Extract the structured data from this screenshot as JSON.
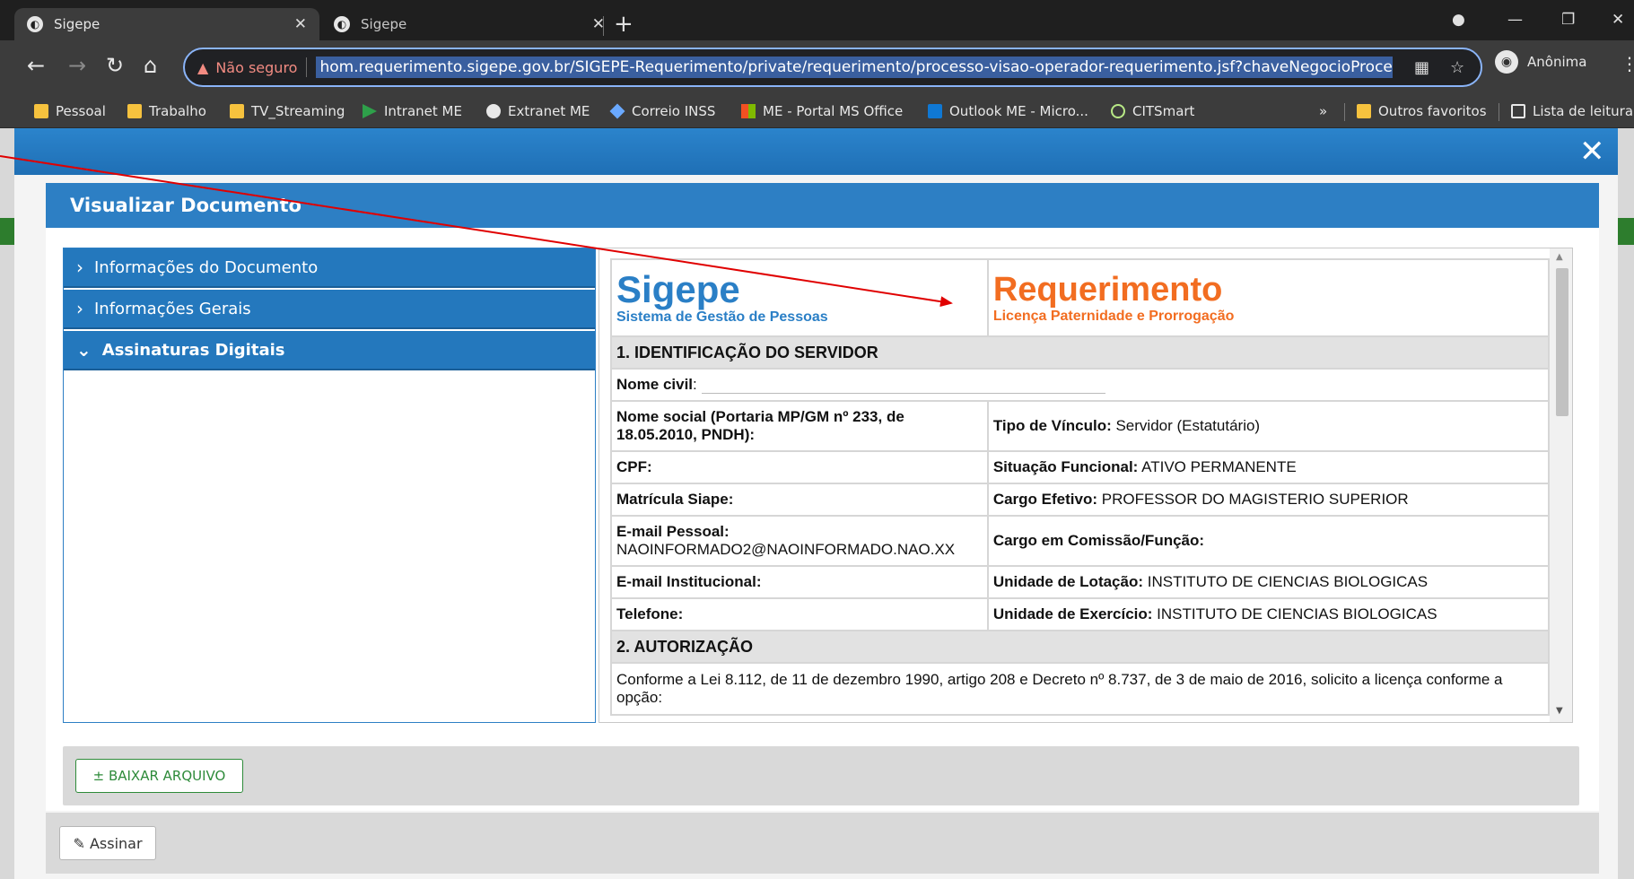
{
  "browser": {
    "tabs": [
      {
        "title": "Sigepe",
        "active": true
      },
      {
        "title": "Sigepe",
        "active": false
      }
    ],
    "new_tab_symbol": "+",
    "security_label": "Não seguro",
    "url": "hom.requerimento.sigepe.gov.br/SIGEPE-Requerimento/private/requerimento/processo-visao-operador-requerimento.jsf?chaveNegocioProcesso",
    "profile_label": "Anônima",
    "bookmarks": [
      {
        "label": "Pessoal",
        "icon": "folder-icon"
      },
      {
        "label": "Trabalho",
        "icon": "folder-icon"
      },
      {
        "label": "TV_Streaming",
        "icon": "folder-icon"
      },
      {
        "label": "Intranet ME",
        "icon": "arrow-icon"
      },
      {
        "label": "Extranet ME",
        "icon": "wordpress-icon"
      },
      {
        "label": "Correio INSS",
        "icon": "diamond-icon"
      },
      {
        "label": "ME - Portal MS Office",
        "icon": "ms-office-icon"
      },
      {
        "label": "Outlook ME - Micro...",
        "icon": "outlook-icon"
      },
      {
        "label": "CITSmart",
        "icon": "citsmart-icon"
      }
    ],
    "bookmarks_overflow": "»",
    "other_favorites": "Outros favoritos",
    "reading_list": "Lista de leitura"
  },
  "modal": {
    "close_symbol": "✕",
    "panel_title": "Visualizar Documento",
    "accordion": [
      {
        "label": "Informações do Documento",
        "open": false
      },
      {
        "label": "Informações Gerais",
        "open": false
      },
      {
        "label": "Assinaturas Digitais",
        "open": true
      }
    ],
    "download_button": "± BAIXAR ARQUIVO",
    "sign_button": "✎ Assinar"
  },
  "document": {
    "brand_name": "Sigepe",
    "brand_subtitle": "Sistema de Gestão de Pessoas",
    "doc_title": "Requerimento",
    "doc_subtitle": "Licença Paternidade e Prorrogação",
    "section1": "1. IDENTIFICAÇÃO DO SERVIDOR",
    "rows": {
      "nome_civil_label": "Nome civil",
      "nome_civil_sep": ":",
      "nome_social_label": "Nome social (Portaria MP/GM nº 233, de 18.05.2010, PNDH):",
      "tipo_vinculo_label": "Tipo de Vínculo:",
      "tipo_vinculo_value": " Servidor (Estatutário)",
      "cpf_label": "CPF:",
      "situacao_label": "Situação Funcional:",
      "situacao_value": " ATIVO PERMANENTE",
      "matricula_label": "Matrícula Siape:",
      "cargo_efetivo_label": "Cargo Efetivo:",
      "cargo_efetivo_value": " PROFESSOR DO MAGISTERIO SUPERIOR",
      "email_pessoal_label": "E-mail Pessoal:",
      "email_pessoal_value": "NAOINFORMADO2@NAOINFORMADO.NAO.XX",
      "cargo_comissao_label": "Cargo em Comissão/Função:",
      "email_inst_label": "E-mail Institucional:",
      "unidade_lotacao_label": "Unidade de Lotação:",
      "unidade_lotacao_value": " INSTITUTO DE CIENCIAS BIOLOGICAS",
      "telefone_label": "Telefone:",
      "unidade_exercicio_label": "Unidade de Exercício:",
      "unidade_exercicio_value": " INSTITUTO DE CIENCIAS BIOLOGICAS"
    },
    "section2": "2. AUTORIZAÇÃO",
    "authorization_text": "Conforme a Lei 8.112, de 11 de dezembro 1990, artigo 208 e Decreto nº 8.737, de 3 de maio de 2016, solicito a licença conforme a opção:"
  },
  "colors": {
    "brand_blue": "#2a7fc6",
    "brand_orange": "#f26d21",
    "header_blue": "#2d7fc4",
    "annotation_red": "#e00000",
    "download_green": "#2e8b3a"
  }
}
